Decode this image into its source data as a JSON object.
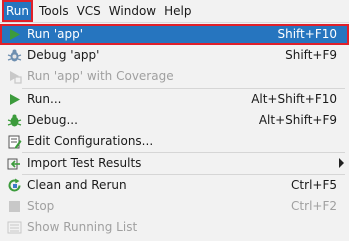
{
  "menubar": {
    "items": [
      "Run",
      "Tools",
      "VCS",
      "Window",
      "Help"
    ]
  },
  "menu": {
    "items": [
      {
        "label": "Run 'app'",
        "shortcut": "Shift+F10",
        "icon": "run-icon"
      },
      {
        "label": "Debug 'app'",
        "shortcut": "Shift+F9",
        "icon": "debug-icon"
      },
      {
        "label": "Run 'app' with Coverage",
        "shortcut": "",
        "icon": "coverage-icon"
      },
      {
        "label": "Run...",
        "shortcut": "Alt+Shift+F10",
        "icon": "run-icon"
      },
      {
        "label": "Debug...",
        "shortcut": "Alt+Shift+F9",
        "icon": "debug-icon"
      },
      {
        "label": "Edit Configurations...",
        "shortcut": "",
        "icon": "edit-configurations-icon"
      },
      {
        "label": "Import Test Results",
        "shortcut": "",
        "icon": "import-test-results-icon"
      },
      {
        "label": "Clean and Rerun",
        "shortcut": "Ctrl+F5",
        "icon": "clean-rerun-icon"
      },
      {
        "label": "Stop",
        "shortcut": "Ctrl+F2",
        "icon": "stop-icon"
      },
      {
        "label": "Show Running List",
        "shortcut": "",
        "icon": "show-running-list-icon"
      }
    ]
  },
  "colors": {
    "selection": "#2675bf",
    "highlight_border": "#e0202a",
    "run_green": "#3c9b3c",
    "disabled": "#a0a0a0"
  }
}
